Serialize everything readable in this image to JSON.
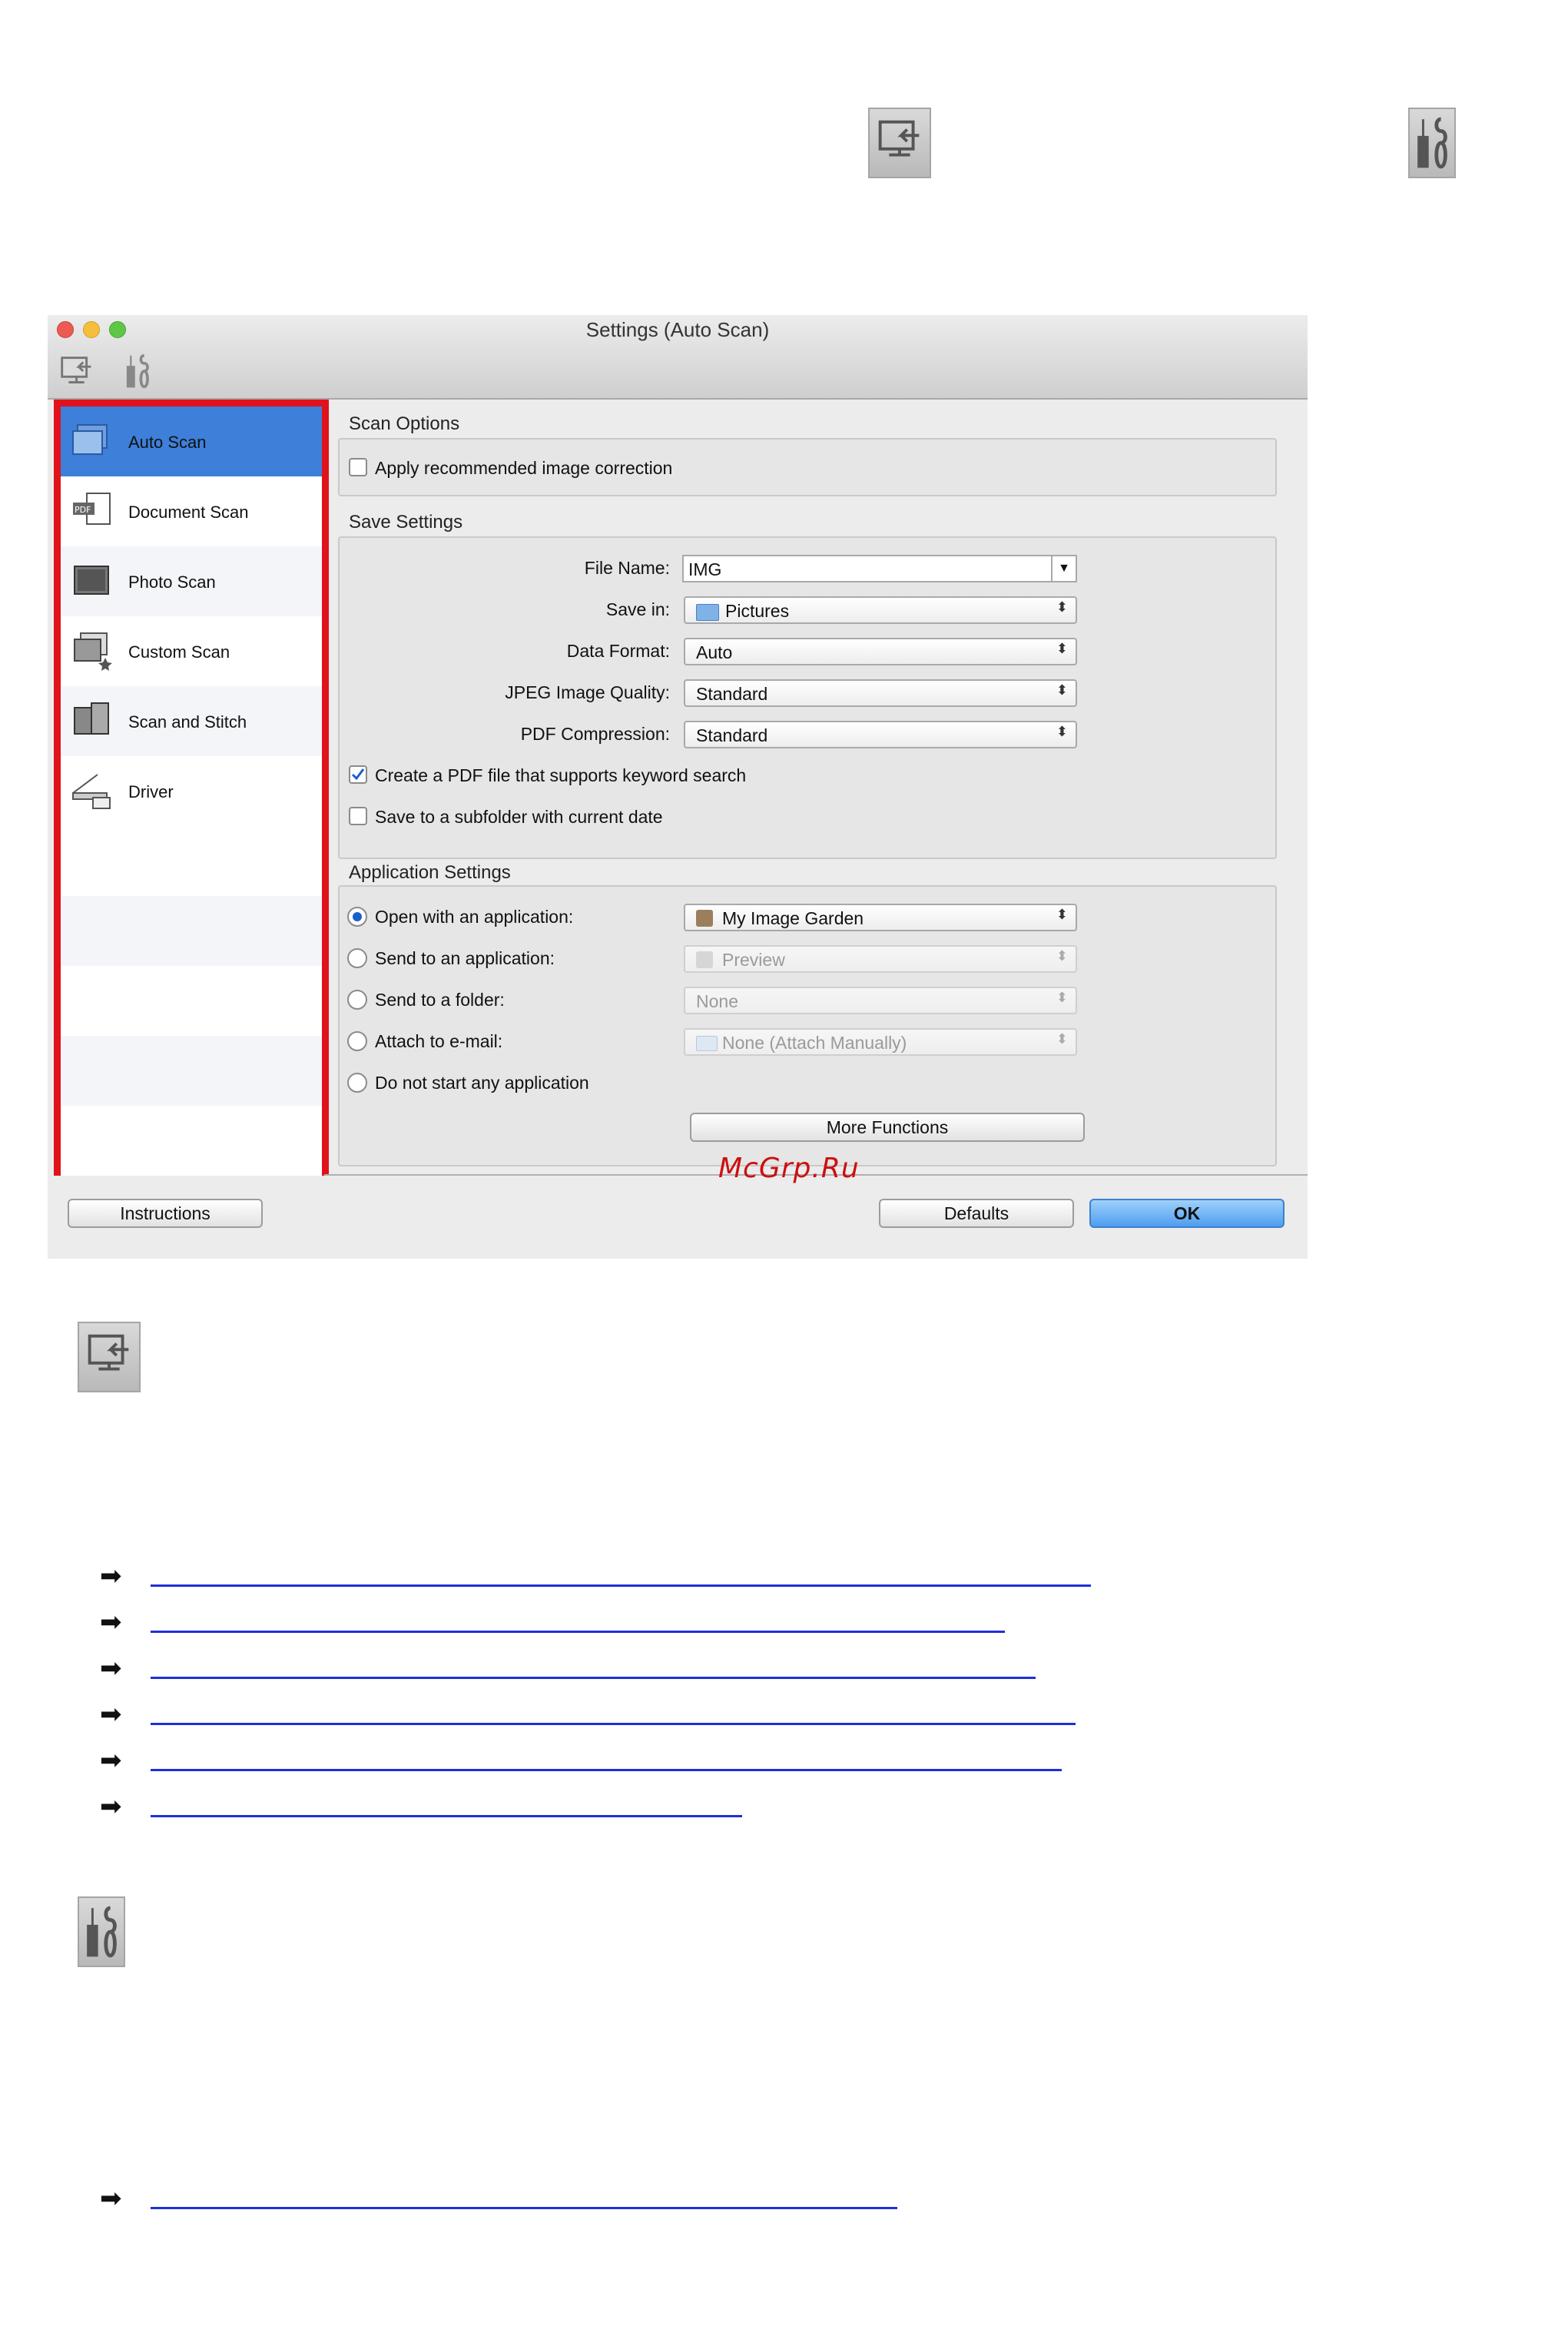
{
  "window": {
    "title": "Settings (Auto Scan)"
  },
  "sidebar": {
    "items": [
      {
        "label": "Auto Scan",
        "icon": "auto-scan-icon",
        "selected": true
      },
      {
        "label": "Document Scan",
        "icon": "document-scan-icon"
      },
      {
        "label": "Photo Scan",
        "icon": "photo-scan-icon"
      },
      {
        "label": "Custom Scan",
        "icon": "custom-scan-icon"
      },
      {
        "label": "Scan and Stitch",
        "icon": "scan-and-stitch-icon"
      },
      {
        "label": "Driver",
        "icon": "driver-icon"
      }
    ]
  },
  "scan_options": {
    "title": "Scan Options",
    "apply_correction": {
      "label": "Apply recommended image correction",
      "checked": false
    }
  },
  "save_settings": {
    "title": "Save Settings",
    "file_name": {
      "label": "File Name:",
      "value": "IMG"
    },
    "save_in": {
      "label": "Save in:",
      "value": "Pictures"
    },
    "data_format": {
      "label": "Data Format:",
      "value": "Auto"
    },
    "jpeg_quality": {
      "label": "JPEG Image Quality:",
      "value": "Standard"
    },
    "pdf_compression": {
      "label": "PDF Compression:",
      "value": "Standard"
    },
    "keyword_pdf": {
      "label": "Create a PDF file that supports keyword search",
      "checked": true
    },
    "subfolder": {
      "label": "Save to a subfolder with current date",
      "checked": false
    }
  },
  "app_settings": {
    "title": "Application Settings",
    "open_with": {
      "label": "Open with an application:",
      "value": "My Image Garden",
      "selected": true
    },
    "send_to_app": {
      "label": "Send to an application:",
      "value": "Preview"
    },
    "send_to_folder": {
      "label": "Send to a folder:",
      "value": "None"
    },
    "attach_email": {
      "label": "Attach to e-mail:",
      "value": "None (Attach Manually)"
    },
    "do_not_start": {
      "label": "Do not start any application"
    },
    "more_functions": "More Functions"
  },
  "footer": {
    "instructions": "Instructions",
    "defaults": "Defaults",
    "ok": "OK"
  },
  "watermark": "McGrp.Ru",
  "colors": {
    "highlight_border": "#e0121c",
    "selection": "#3d7fd9",
    "link": "#1f2fd8"
  }
}
